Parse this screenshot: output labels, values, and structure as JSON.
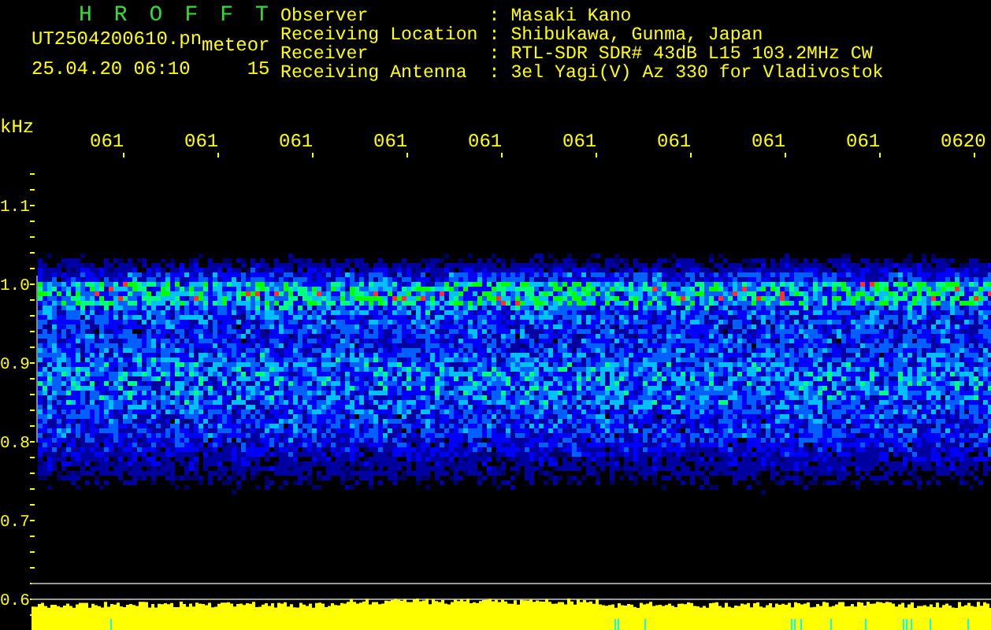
{
  "app": {
    "title": "HROFFT"
  },
  "file": {
    "filename": "UT2504200610.pn",
    "mode": "meteor",
    "timestamp": "25.04.20 06:10",
    "count": "15"
  },
  "info": [
    {
      "label": "Observer",
      "separator": ":",
      "value": "Masaki Kano"
    },
    {
      "label": "Receiving Location",
      "separator": ":",
      "value": "Shibukawa, Gunma, Japan"
    },
    {
      "label": "Receiver",
      "separator": ":",
      "value": "RTL-SDR SDR# 43dB L15 103.2MHz CW"
    },
    {
      "label": "Receiving Antenna",
      "separator": ":",
      "value": "3el Yagi(V) Az 330 for Vladivostok"
    }
  ],
  "spectrogram": {
    "unit": "kHz",
    "time_labels": [
      "061",
      "061",
      "061",
      "061",
      "061",
      "061",
      "061",
      "061",
      "061",
      "0620"
    ],
    "freq_labels": [
      "1.1",
      "1.0",
      "0.9",
      "0.8",
      "0.7",
      "0.6"
    ]
  }
}
